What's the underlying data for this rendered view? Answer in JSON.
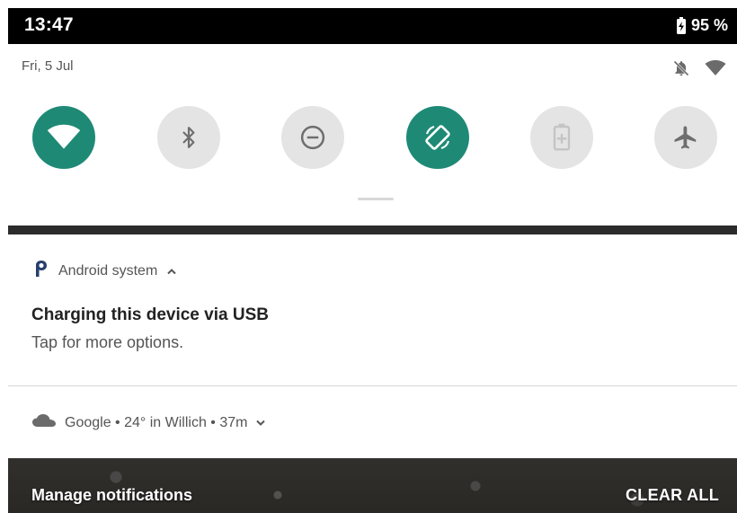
{
  "status_bar": {
    "time": "13:47",
    "battery_percent": "95 %",
    "battery_icon": "battery-charging-icon"
  },
  "quick_settings": {
    "date": "Fri, 5 Jul",
    "top_icons": [
      "notifications-off-icon",
      "wifi-signal-icon"
    ],
    "tiles": [
      {
        "name": "wifi",
        "icon": "wifi-icon",
        "active": true
      },
      {
        "name": "bluetooth",
        "icon": "bluetooth-icon",
        "active": false
      },
      {
        "name": "do-not-disturb",
        "icon": "do-not-disturb-icon",
        "active": false
      },
      {
        "name": "auto-rotate",
        "icon": "auto-rotate-icon",
        "active": true
      },
      {
        "name": "battery-saver",
        "icon": "battery-saver-icon",
        "active": false
      },
      {
        "name": "airplane-mode",
        "icon": "airplane-icon",
        "active": false
      }
    ],
    "accent_color": "#1e8a76"
  },
  "notification": {
    "app_name": "Android system",
    "app_icon": "android-system-p-icon",
    "expand_icon": "chevron-up-icon",
    "title": "Charging this device via USB",
    "text": "Tap for more options."
  },
  "weather": {
    "icon": "cloud-icon",
    "summary": "Google • 24° in Willich • 37m",
    "expand_icon": "chevron-down-icon"
  },
  "footer": {
    "manage_label": "Manage notifications",
    "clear_label": "CLEAR ALL"
  }
}
